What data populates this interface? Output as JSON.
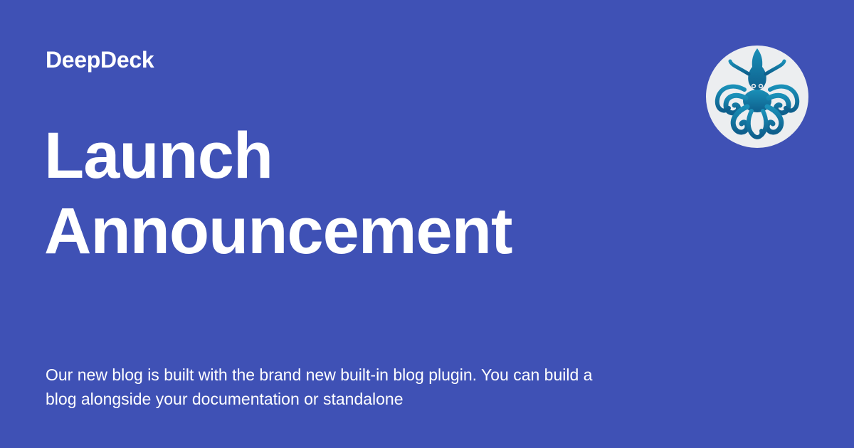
{
  "card": {
    "site_name": "DeepDeck",
    "title_line1": "Launch",
    "title_line2": "Announcement",
    "description": "Our new blog is built with the brand new built-in blog plugin. You can build a blog alongside your documentation or standalone",
    "logo_icon": "octopus-icon"
  },
  "colors": {
    "background": "#3F51B5",
    "text": "#FFFFFF",
    "logo_circle": "#ECEEF0",
    "logo_fill": "#1479A6"
  }
}
